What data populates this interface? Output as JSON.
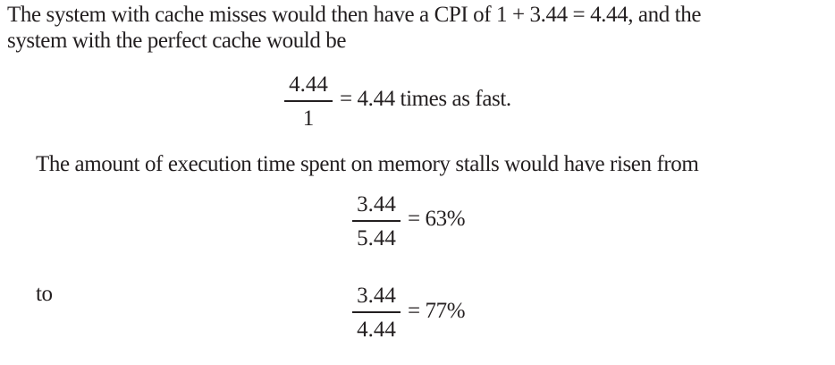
{
  "paragraph1": {
    "line1": "The system with cache misses would then have a CPI of 1 + 3.44 = 4.44, and the",
    "line2": "system with the perfect cache would be"
  },
  "equation1": {
    "numerator": "4.44",
    "denominator": "1",
    "result": "= 4.44 times as fast."
  },
  "paragraph2": "The amount of execution time spent on memory stalls would have risen from",
  "equation2": {
    "numerator": "3.44",
    "denominator": "5.44",
    "result": "= 63%"
  },
  "connector": "to",
  "equation3": {
    "numerator": "3.44",
    "denominator": "4.44",
    "result": "= 77%"
  }
}
